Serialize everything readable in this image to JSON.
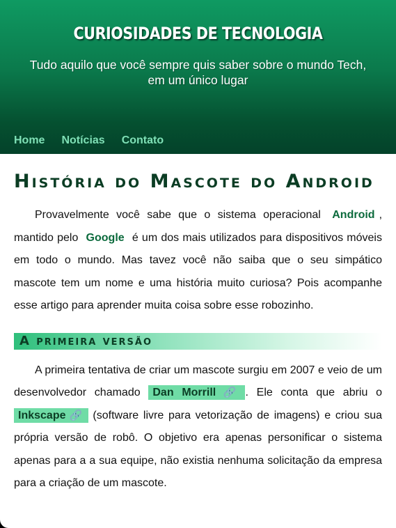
{
  "header": {
    "title": "CURIOSIDADES DE TECNOLOGIA",
    "subtitle": "Tudo aquilo que você sempre quis saber sobre o mundo Tech, em um único lugar"
  },
  "nav": {
    "items": [
      "Home",
      "Notícias",
      "Contato"
    ]
  },
  "article": {
    "title": "História do Mascote do Android",
    "intro": {
      "t1": "Provavelmente você sabe que o sistema operacional",
      "k1": "Android",
      "t2": ", mantido pelo",
      "k2": "Google",
      "t3": "é um dos mais utilizados para dispositivos móveis em todo o mundo. Mas tavez você não saiba que o seu simpático mascote tem um nome e uma história muito curiosa? Pois acompanhe esse artigo para aprender muita coisa sobre esse robozinho."
    },
    "section1": {
      "heading": "A primeira versão",
      "t1": "A primeira tentativa de criar um mascote surgiu em 2007 e veio de um desenvolvedor chamado",
      "link1": "Dan Morrill",
      "t2": ". Ele conta que abriu o",
      "link2": "Inkscape",
      "t3": "(software livre para vetorização de imagens) e criou sua própria versão de robô. O objetivo era apenas personificar o sistema apenas para a a sua equipe, não existia nenhuma solicitação da empresa para a criação de um mascote."
    }
  },
  "icons": {
    "external_link": "link-icon"
  },
  "colors": {
    "header_top": "#0f9a62",
    "header_bottom": "#04422a",
    "nav_link": "#7fe0b6",
    "title": "#0b3d24",
    "highlight": "#6fdca6"
  }
}
